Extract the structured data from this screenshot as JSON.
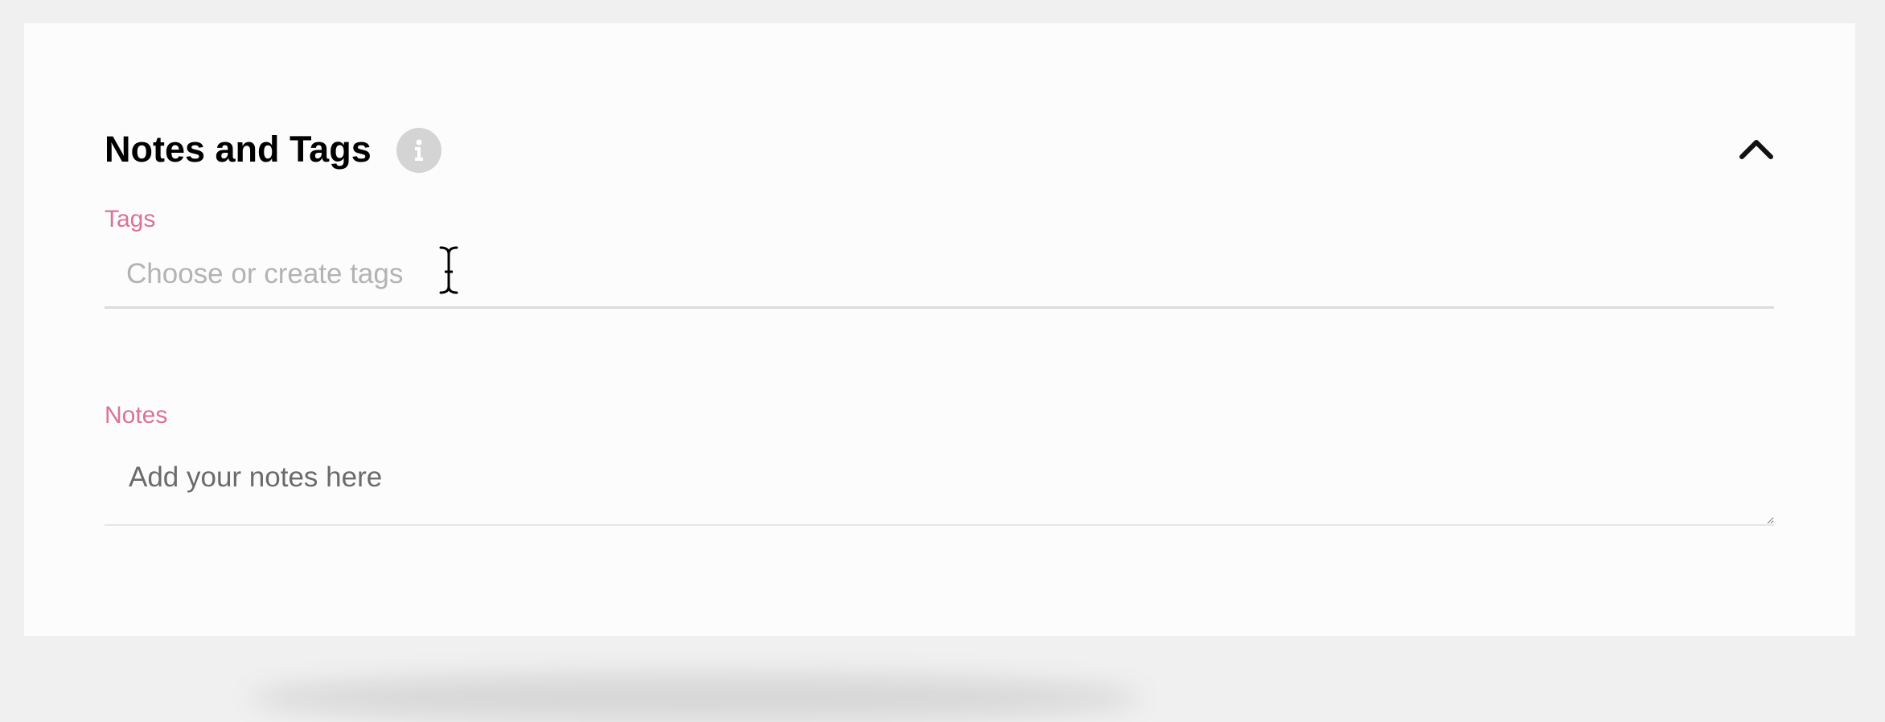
{
  "section": {
    "title": "Notes and Tags",
    "info_icon": "info-icon",
    "collapse_icon": "chevron-up-icon"
  },
  "tags": {
    "label": "Tags",
    "placeholder": "Choose or create tags",
    "value": ""
  },
  "notes": {
    "label": "Notes",
    "placeholder": "Add your notes here",
    "value": ""
  },
  "colors": {
    "label_accent": "#d9739a",
    "title": "#000000",
    "info_icon_bg": "#d4d4d4",
    "panel_bg": "#fcfcfc",
    "page_bg": "#f0f0f0"
  }
}
